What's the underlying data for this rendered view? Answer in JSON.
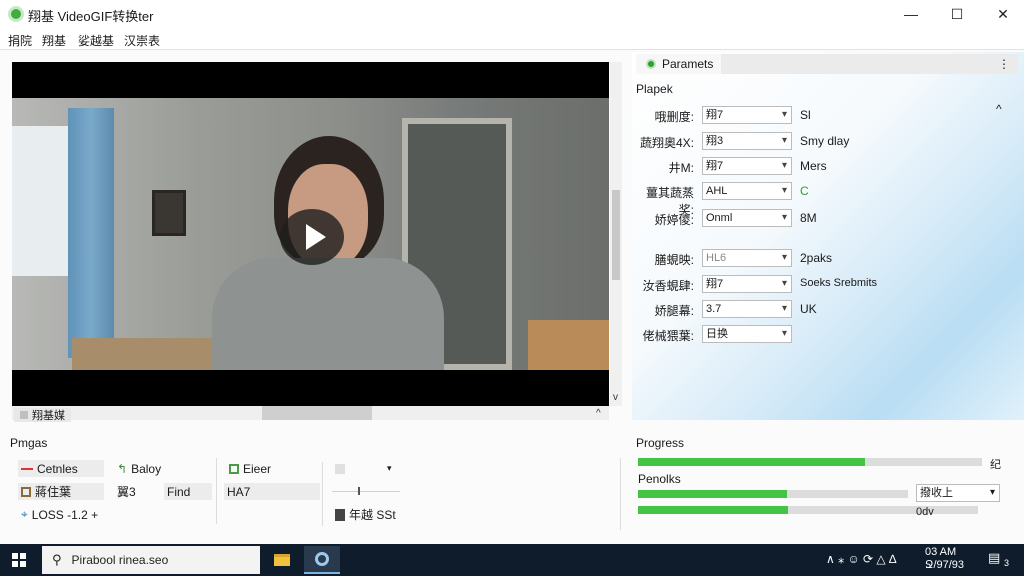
{
  "window": {
    "title": "翔基 VideoGIF转换ter",
    "controls": {
      "minimize": "—",
      "maximize": "☐",
      "close": "✕"
    }
  },
  "menu": [
    "捐院",
    "翔基",
    "娑越基",
    "汉崇表"
  ],
  "video": {
    "tab_label": "翔基媒",
    "scroll_up": "^",
    "scroll_down": "v"
  },
  "tools": {
    "section_title": "Pmgas",
    "rows": [
      [
        {
          "icon": "cut-icon",
          "label": "Cetnles"
        },
        {
          "icon": "filter-icon",
          "label": "Baloy"
        },
        {
          "icon": "grid-icon",
          "label": "Eieer"
        },
        {
          "icon": "blank-icon",
          "label": ""
        }
      ],
      [
        {
          "icon": "image-icon",
          "label": "蔣住葉"
        },
        {
          "icon": "",
          "label": "翼3"
        },
        {
          "icon": "",
          "label": "Find"
        },
        {
          "icon": "",
          "label": "HA7"
        }
      ],
      [
        {
          "icon": "crosshair-icon",
          "label": "LOSS -1.2 +"
        },
        {
          "icon": "film-icon",
          "label": "年越 SSt"
        }
      ]
    ],
    "dropdown_caret": "▾"
  },
  "params": {
    "tab_label": "Paramets",
    "menu_glyph": "⋮",
    "group_title": "Plapek",
    "collapse_glyph": "^",
    "rows": [
      {
        "label": "哦删度:",
        "value": "翔7",
        "note": "Sl"
      },
      {
        "label": "蔬翔奧4X:",
        "value": "翔3",
        "note": "Smy dlay"
      },
      {
        "label": "井M:",
        "value": "翔7",
        "note": "Mers"
      },
      {
        "label": "薑其蔬蒸奖:",
        "value": "AHL",
        "note": "C"
      },
      {
        "label": "娇婷儍:",
        "value": "Onml",
        "note": "8M"
      },
      {
        "label": "膳蜆映:",
        "value": "HL6",
        "note": "2paks"
      },
      {
        "label": "汝香蜆肆:",
        "value": "翔7",
        "note": "Soeks Srebmits"
      },
      {
        "label": "娇腿幕:",
        "value": "3.7",
        "note": "UK"
      },
      {
        "label": "佬械猥葉:",
        "value": "日换",
        "note": ""
      }
    ],
    "accent_note_color": "#2ea02e"
  },
  "progress": {
    "title": "Progress",
    "overall_pct": 0.66,
    "overall_label": "纪",
    "sub_title": "Penolks",
    "bars": [
      0.55,
      0.44
    ],
    "output_label": "撥收上",
    "output_status": "0dv"
  },
  "taskbar": {
    "search_text": "Pirabool rinea.seo",
    "tray_icons": "∧  ⁎  ☺  ⟳  △  ∆",
    "time": "03 AM",
    "date": "Ջ/97/93",
    "notifications": "3"
  }
}
